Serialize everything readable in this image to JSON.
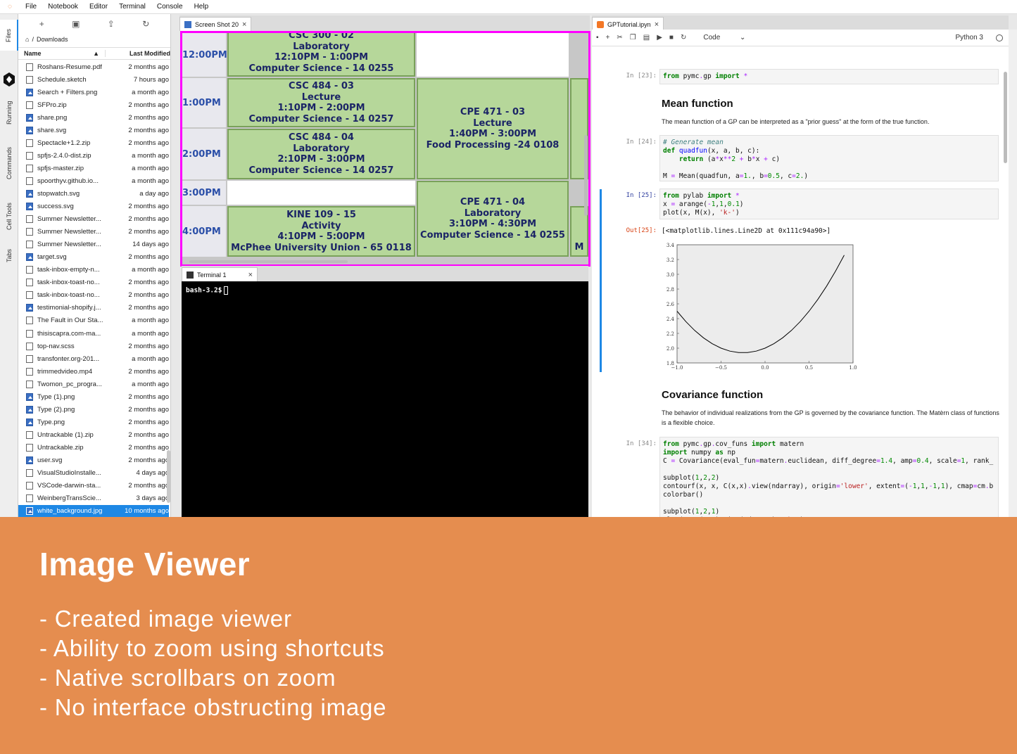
{
  "menubar": {
    "items": [
      "File",
      "Notebook",
      "Editor",
      "Terminal",
      "Console",
      "Help"
    ]
  },
  "left_tabs": [
    "Files",
    "Running",
    "Commands",
    "Cell Tools",
    "Tabs"
  ],
  "filebrowser": {
    "breadcrumb": "Downloads",
    "header_name": "Name",
    "header_modified": "Last Modified",
    "files": [
      {
        "name": "Roshans-Resume.pdf",
        "modified": "2 months ago",
        "type": "doc"
      },
      {
        "name": "Schedule.sketch",
        "modified": "7 hours ago",
        "type": "doc"
      },
      {
        "name": "Search + Filters.png",
        "modified": "a month ago",
        "type": "img"
      },
      {
        "name": "SFPro.zip",
        "modified": "2 months ago",
        "type": "doc"
      },
      {
        "name": "share.png",
        "modified": "2 months ago",
        "type": "img"
      },
      {
        "name": "share.svg",
        "modified": "2 months ago",
        "type": "img"
      },
      {
        "name": "Spectacle+1.2.zip",
        "modified": "2 months ago",
        "type": "doc"
      },
      {
        "name": "spfjs-2.4.0-dist.zip",
        "modified": "a month ago",
        "type": "doc"
      },
      {
        "name": "spfjs-master.zip",
        "modified": "a month ago",
        "type": "doc"
      },
      {
        "name": "spoorthyv.github.io...",
        "modified": "a month ago",
        "type": "doc"
      },
      {
        "name": "stopwatch.svg",
        "modified": "a day ago",
        "type": "img"
      },
      {
        "name": "success.svg",
        "modified": "2 months ago",
        "type": "img"
      },
      {
        "name": "Summer Newsletter...",
        "modified": "2 months ago",
        "type": "doc"
      },
      {
        "name": "Summer Newsletter...",
        "modified": "2 months ago",
        "type": "doc"
      },
      {
        "name": "Summer Newsletter...",
        "modified": "14 days ago",
        "type": "doc"
      },
      {
        "name": "target.svg",
        "modified": "2 months ago",
        "type": "img"
      },
      {
        "name": "task-inbox-empty-n...",
        "modified": "a month ago",
        "type": "doc"
      },
      {
        "name": "task-inbox-toast-no...",
        "modified": "2 months ago",
        "type": "doc"
      },
      {
        "name": "task-inbox-toast-no...",
        "modified": "2 months ago",
        "type": "doc"
      },
      {
        "name": "testimonial-shopify.j...",
        "modified": "2 months ago",
        "type": "img"
      },
      {
        "name": "The Fault in Our Sta...",
        "modified": "a month ago",
        "type": "doc"
      },
      {
        "name": "thisiscapra.com-ma...",
        "modified": "a month ago",
        "type": "doc"
      },
      {
        "name": "top-nav.scss",
        "modified": "2 months ago",
        "type": "doc"
      },
      {
        "name": "transfonter.org-201...",
        "modified": "a month ago",
        "type": "doc"
      },
      {
        "name": "trimmedvideo.mp4",
        "modified": "2 months ago",
        "type": "doc"
      },
      {
        "name": "Twomon_pc_progra...",
        "modified": "a month ago",
        "type": "doc"
      },
      {
        "name": "Type (1).png",
        "modified": "2 months ago",
        "type": "img"
      },
      {
        "name": "Type (2).png",
        "modified": "2 months ago",
        "type": "img"
      },
      {
        "name": "Type.png",
        "modified": "2 months ago",
        "type": "img"
      },
      {
        "name": "Untrackable (1).zip",
        "modified": "2 months ago",
        "type": "doc"
      },
      {
        "name": "Untrackable.zip",
        "modified": "2 months ago",
        "type": "doc"
      },
      {
        "name": "user.svg",
        "modified": "2 months ago",
        "type": "img"
      },
      {
        "name": "VisualStudioInstalle...",
        "modified": "4 days ago",
        "type": "doc"
      },
      {
        "name": "VSCode-darwin-sta...",
        "modified": "2 months ago",
        "type": "doc"
      },
      {
        "name": "WeinbergTransScie...",
        "modified": "3 days ago",
        "type": "doc"
      },
      {
        "name": "white_background.jpg",
        "modified": "10 months ago",
        "type": "img",
        "selected": true
      }
    ]
  },
  "image_viewer": {
    "tab_label": "Screen Shot 20",
    "times": [
      "12:00PM",
      "1:00PM",
      "2:00PM",
      "3:00PM",
      "4:00PM"
    ],
    "blocks": [
      {
        "lines": [
          "CSC 300 - 02",
          "Laboratory",
          "12:10PM - 1:00PM",
          "Computer Science - 14 0255"
        ]
      },
      {
        "lines": [
          "CSC 484 - 03",
          "Lecture",
          "1:10PM - 2:00PM",
          "Computer Science - 14 0257"
        ]
      },
      {
        "lines": [
          "CSC 484 - 04",
          "Laboratory",
          "2:10PM - 3:00PM",
          "Computer Science - 14 0257"
        ]
      },
      {
        "lines": [
          "KINE 109 - 15",
          "Activity",
          "4:10PM - 5:00PM",
          "McPhee University Union - 65 0118"
        ]
      },
      {
        "lines": [
          "CPE 471 - 03",
          "Lecture",
          "1:40PM - 3:00PM",
          "Food Processing -24 0108"
        ]
      },
      {
        "lines": [
          "CPE 471 - 04",
          "Laboratory",
          "3:10PM - 4:30PM",
          "Computer Science - 14 0255"
        ]
      },
      {
        "lines": [
          "M"
        ]
      }
    ]
  },
  "terminal": {
    "tab_label": "Terminal 1",
    "prompt": "bash-3.2$"
  },
  "notebook": {
    "tab_label": "GPTutorial.ipyn",
    "cell_type": "Code",
    "kernel": "Python 3",
    "cells": {
      "c23_prompt": "In [23]:",
      "c24_prompt": "In [24]:",
      "c25_prompt": "In [25]:",
      "out25_prompt": "Out[25]:",
      "c34_prompt": "In [34]:",
      "mean_heading": "Mean function",
      "mean_text": "The mean function of a GP can be interpreted as a \"prior guess\" at the form of the true function.",
      "out25_text": "[<matplotlib.lines.Line2D at 0x111c94a90>]",
      "cov_heading": "Covariance function",
      "cov_text": "The behavior of individual realizations from the GP is governed by the covariance function. The Matèrn class of functions is a flexible choice."
    }
  },
  "chart_data": {
    "type": "line",
    "title": "",
    "xlabel": "",
    "ylabel": "",
    "xlim": [
      -1.0,
      1.0
    ],
    "ylim": [
      1.8,
      3.4
    ],
    "xticks": [
      "−1.0",
      "−0.5",
      "0.0",
      "0.5",
      "1.0"
    ],
    "yticks": [
      "1.8",
      "2.0",
      "2.2",
      "2.4",
      "2.6",
      "2.8",
      "3.0",
      "3.2",
      "3.4"
    ],
    "series": [
      {
        "function": "x**2 + 0.5*x + 2",
        "x_range": [
          -1.0,
          1.0
        ],
        "step": 0.1,
        "color": "#000000"
      }
    ]
  },
  "caption": {
    "title": "Image Viewer",
    "bullets": [
      "- Created image viewer",
      "- Ability to zoom using shortcuts",
      "- Native scrollbars on zoom",
      "- No interface obstructing image"
    ]
  }
}
